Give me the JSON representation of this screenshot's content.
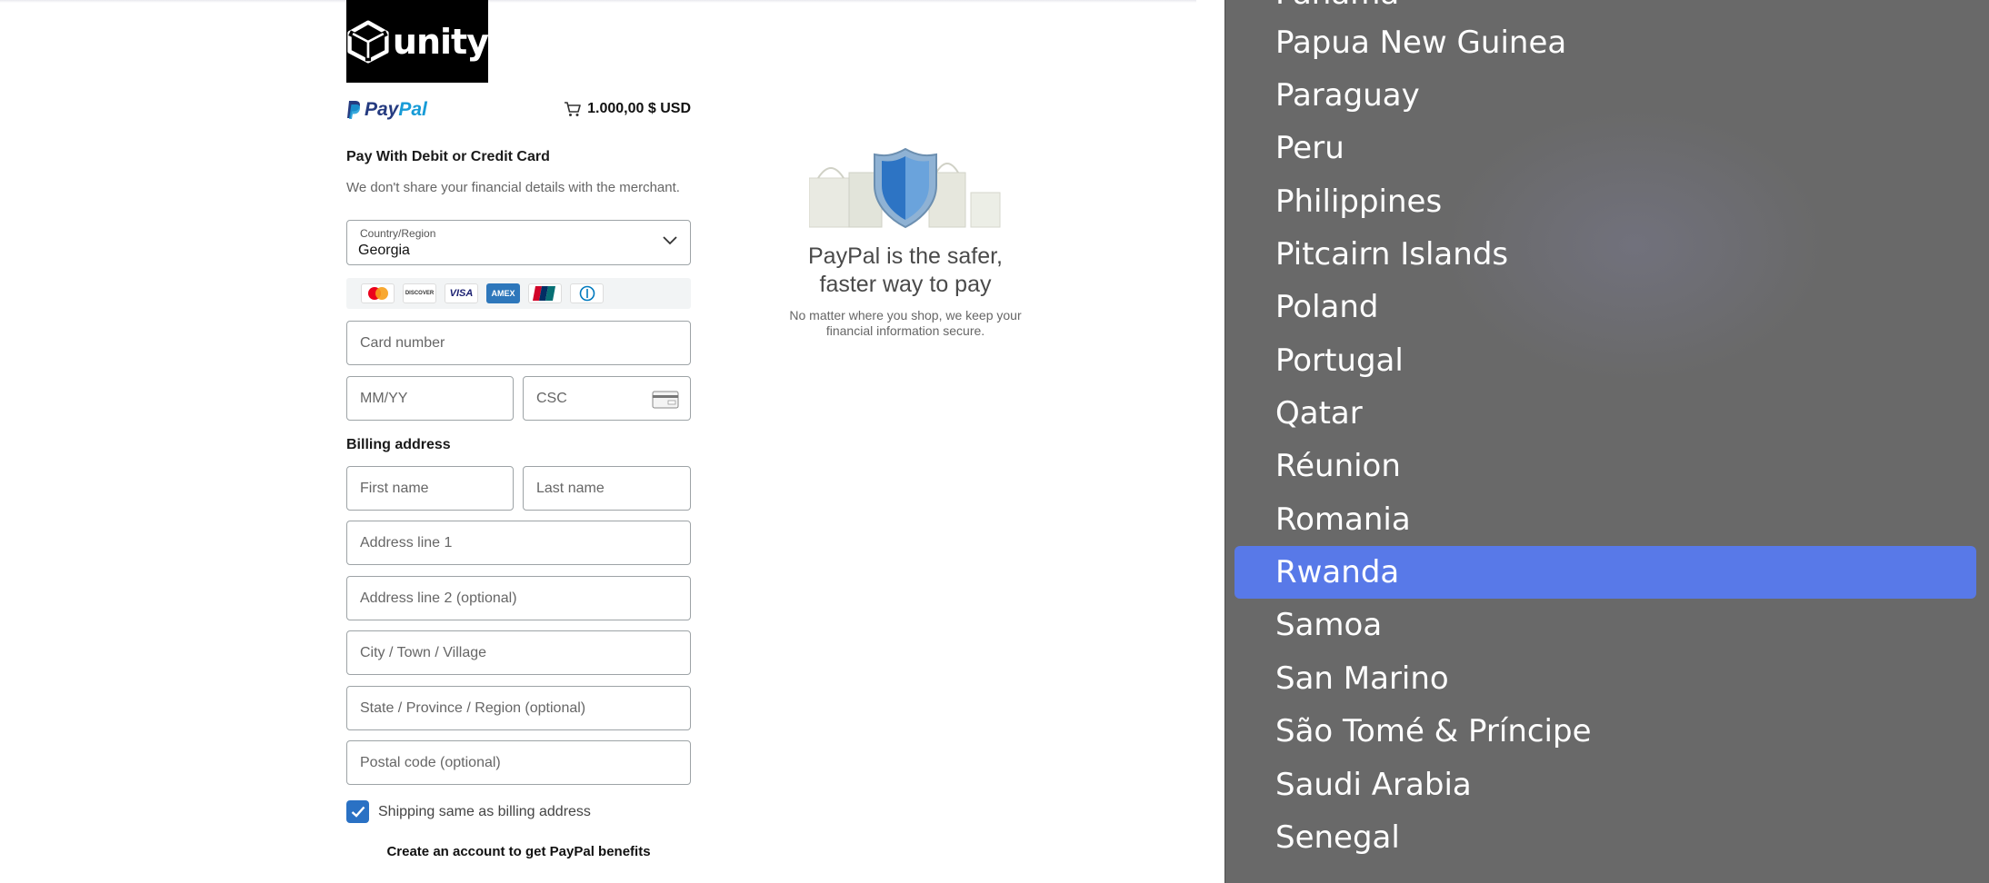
{
  "merchant": {
    "logo_text": "unity"
  },
  "paypal": {
    "brand_pay": "Pay",
    "brand_pal": "Pal",
    "cart_total": "1.000,00 $ USD"
  },
  "form": {
    "heading": "Pay With Debit or Credit Card",
    "subtext": "We don't share your financial details with the merchant.",
    "country_label": "Country/Region",
    "country_value": "Georgia",
    "card_logos": [
      {
        "name": "mastercard",
        "text": ""
      },
      {
        "name": "discover",
        "text": "DISCOVER"
      },
      {
        "name": "visa",
        "text": "VISA"
      },
      {
        "name": "amex",
        "text": "AMEX"
      },
      {
        "name": "unionpay",
        "text": ""
      },
      {
        "name": "diners",
        "text": ""
      }
    ],
    "card_number_placeholder": "Card number",
    "expiry_placeholder": "MM/YY",
    "csc_placeholder": "CSC",
    "billing_label": "Billing address",
    "first_name_placeholder": "First name",
    "last_name_placeholder": "Last name",
    "address1_placeholder": "Address line 1",
    "address2_placeholder": "Address line 2 (optional)",
    "city_placeholder": "City / Town / Village",
    "state_placeholder": "State / Province / Region (optional)",
    "postal_placeholder": "Postal code (optional)",
    "shipping_same_label": "Shipping same as billing address",
    "shipping_same_checked": true,
    "create_account": "Create an account to get PayPal benefits"
  },
  "promo": {
    "title": "PayPal is the safer, faster way to pay",
    "description": "No matter where you shop, we keep your financial information secure."
  },
  "country_dropdown": {
    "partial_top": "Panama",
    "items": [
      "Papua New Guinea",
      "Paraguay",
      "Peru",
      "Philippines",
      "Pitcairn Islands",
      "Poland",
      "Portugal",
      "Qatar",
      "Réunion",
      "Romania",
      "Rwanda",
      "Samoa",
      "San Marino",
      "São Tomé & Príncipe",
      "Saudi Arabia",
      "Senegal"
    ],
    "selected": "Rwanda"
  },
  "colors": {
    "selected_highlight": "#5879e8",
    "dropdown_bg": "#696969",
    "checkbox": "#2a71c4"
  }
}
